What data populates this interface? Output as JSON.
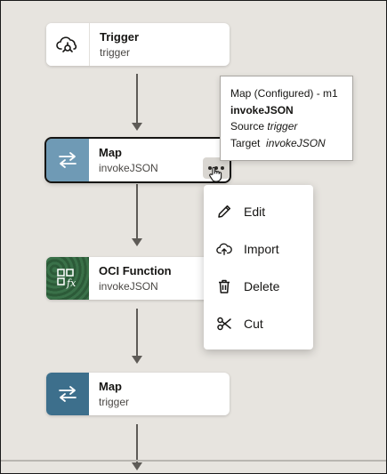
{
  "colors": {
    "canvas_bg": "#e7e4df",
    "map_tile_selected": "#6f9ab5",
    "map_tile": "#3d6f8c",
    "oci_tile": "#2f5f3c",
    "connector": "#5e5b57"
  },
  "nodes": [
    {
      "title": "Trigger",
      "subtitle": "trigger",
      "icon": "cloud-trigger-icon"
    },
    {
      "title": "Map",
      "subtitle": "invokeJSON",
      "icon": "swap-arrows-icon",
      "selected": true
    },
    {
      "title": "OCI Function",
      "subtitle": "invokeJSON",
      "icon": "oci-function-icon"
    },
    {
      "title": "Map",
      "subtitle": "trigger",
      "icon": "swap-arrows-icon"
    }
  ],
  "tooltip": {
    "line1": "Map (Configured) - m1",
    "line2": "invokeJSON",
    "source_label": "Source",
    "source_value": "trigger",
    "target_label": "Target",
    "target_value": "invokeJSON"
  },
  "menu": {
    "items": [
      {
        "label": "Edit",
        "icon": "pencil-icon"
      },
      {
        "label": "Import",
        "icon": "cloud-upload-icon"
      },
      {
        "label": "Delete",
        "icon": "trash-icon"
      },
      {
        "label": "Cut",
        "icon": "scissors-icon"
      }
    ]
  }
}
